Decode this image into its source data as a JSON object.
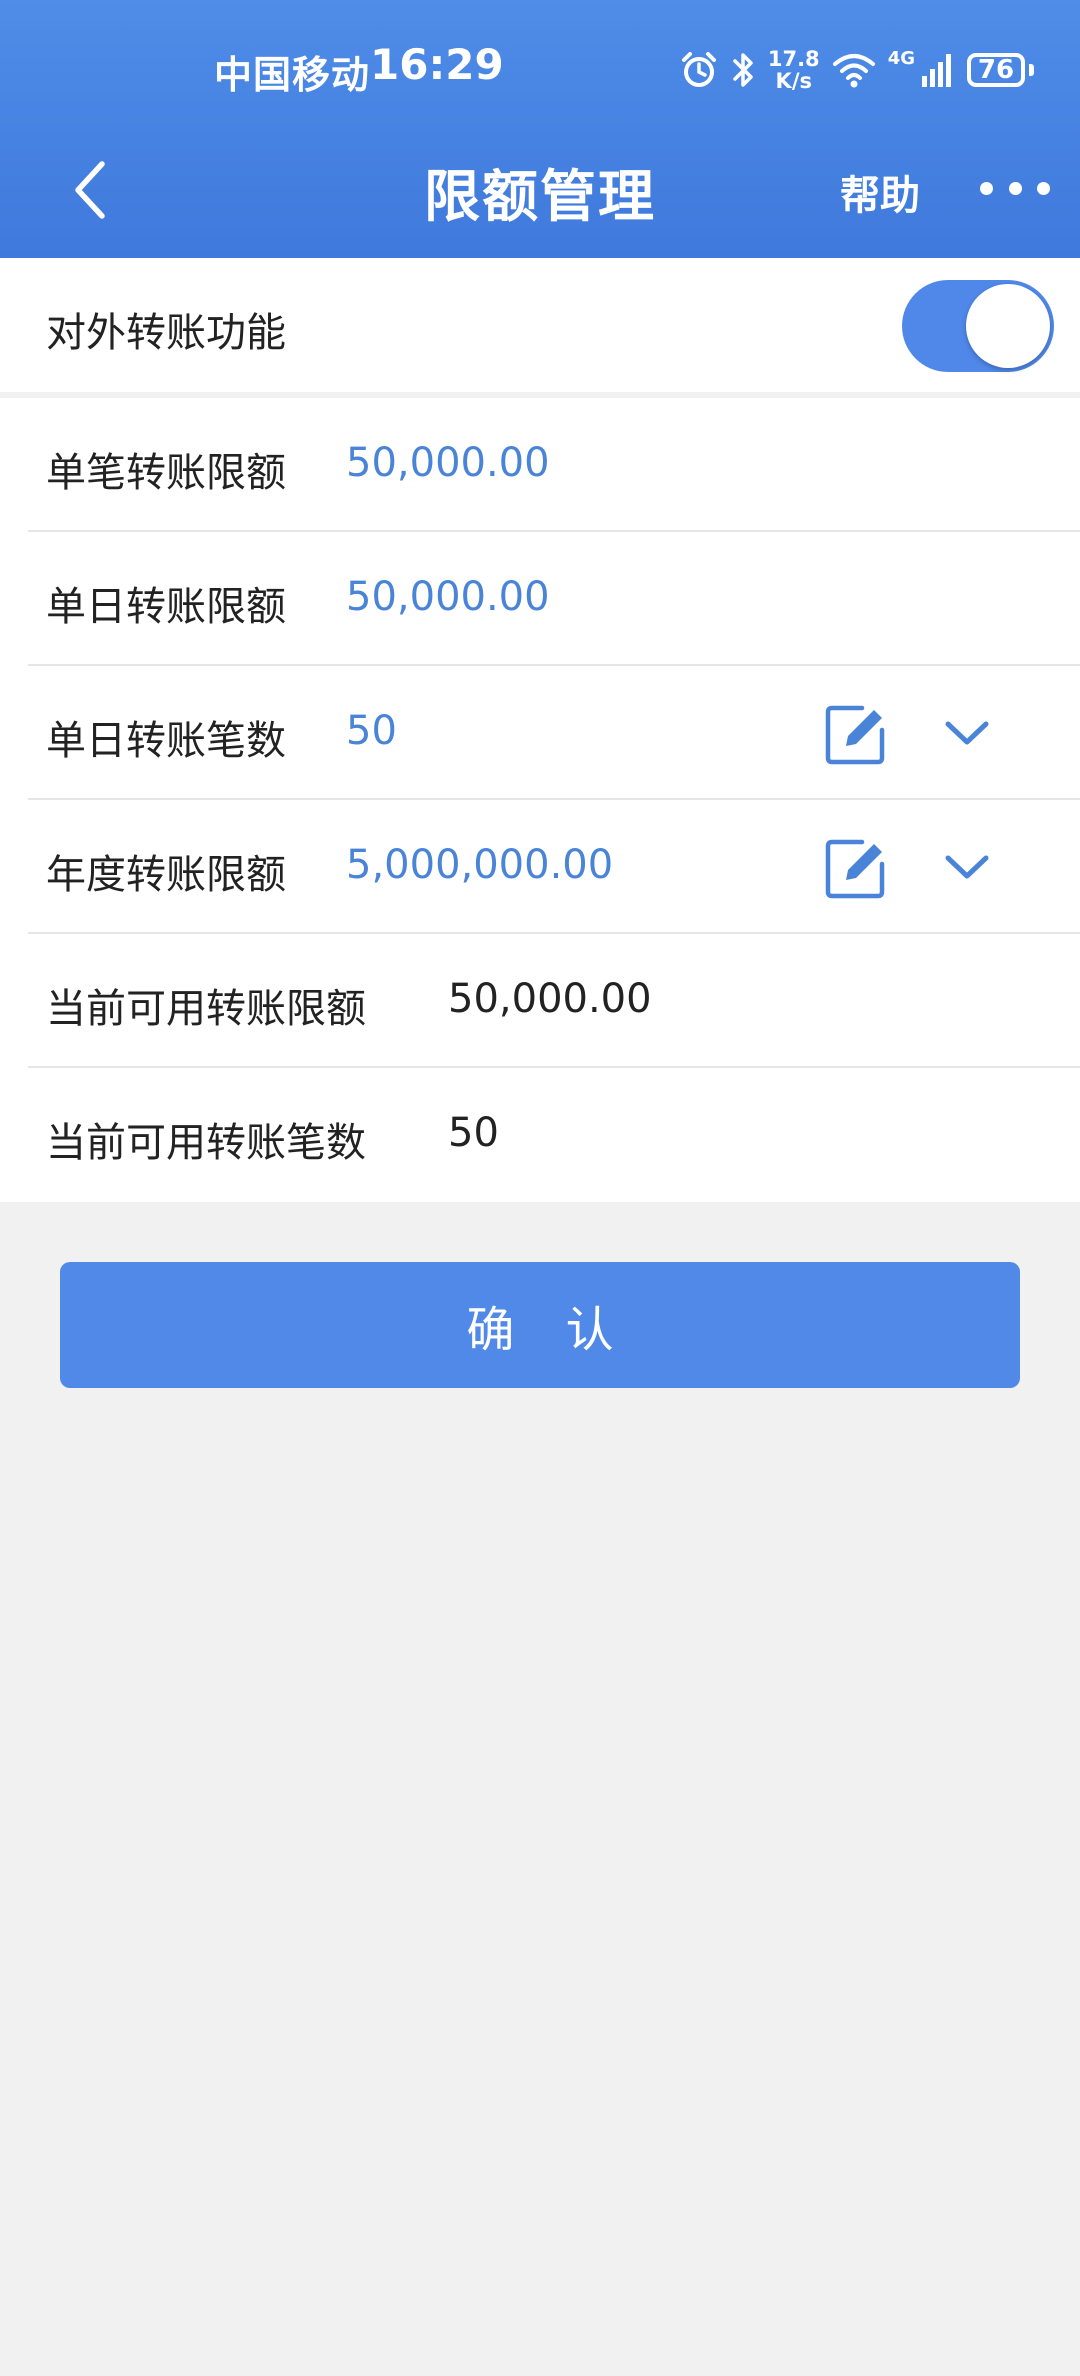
{
  "status_bar": {
    "carrier": "中国移动",
    "time": "16:29",
    "net_speed_top": "17.8",
    "net_speed_bottom": "K/s",
    "network_type": "4G",
    "battery": "76",
    "icons": [
      "alarm-icon",
      "bluetooth-icon",
      "wifi-icon",
      "signal-icon",
      "battery-icon"
    ]
  },
  "nav": {
    "title": "限额管理",
    "help_label": "帮助",
    "back_icon": "chevron-left-icon",
    "more_icon": "more-dots-icon"
  },
  "transfer_toggle": {
    "label": "对外转账功能",
    "enabled": true
  },
  "limits": [
    {
      "label": "单笔转账限额",
      "value": "50,000.00",
      "editable": false
    },
    {
      "label": "单日转账限额",
      "value": "50,000.00",
      "editable": false
    },
    {
      "label": "单日转账笔数",
      "value": "50",
      "editable": true
    },
    {
      "label": "年度转账限额",
      "value": "5,000,000.00",
      "editable": true
    },
    {
      "label": "当前可用转账限额",
      "value": "50,000.00",
      "editable": false
    },
    {
      "label": "当前可用转账笔数",
      "value": "50",
      "editable": false
    }
  ],
  "confirm_label": "确 认",
  "colors": {
    "header": "#4285e4",
    "accent": "#5189e9",
    "value_blue": "#4a84d8",
    "background": "#f1f1f1"
  }
}
